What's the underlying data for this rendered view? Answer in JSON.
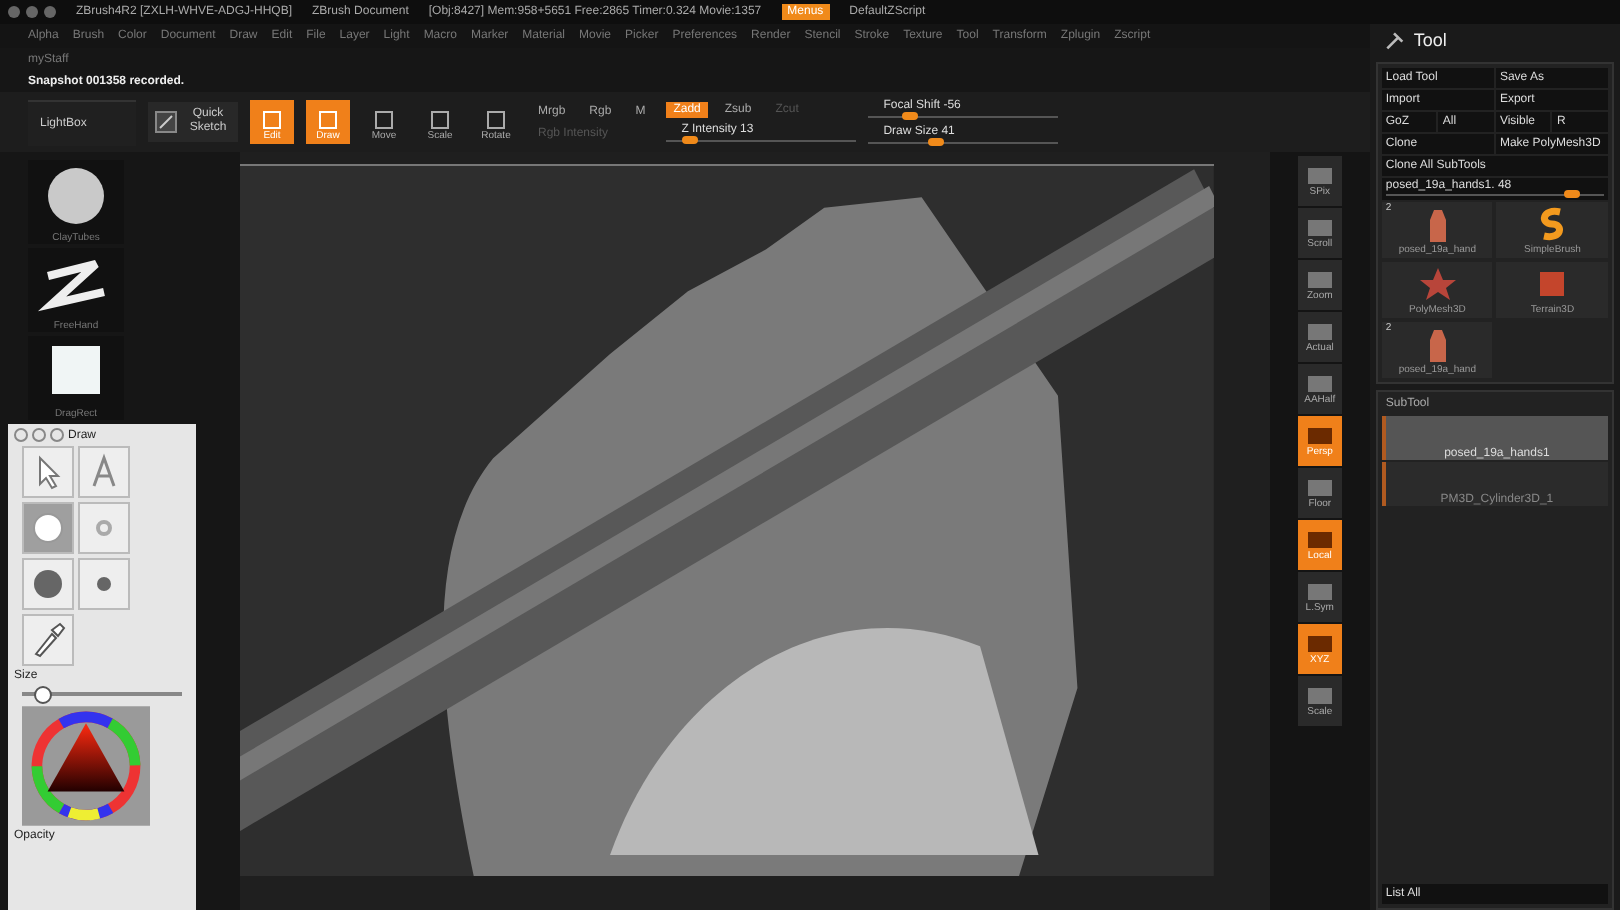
{
  "title_bar": {
    "app": "ZBrush4R2 [ZXLH-WHVE-ADGJ-HHQB]",
    "document": "ZBrush Document",
    "stats": "[Obj:8427] Mem:958+5651 Free:2865 Timer:0.324 Movie:1357",
    "menus_button": {
      "label": "Menus",
      "on": true
    },
    "script": "DefaultZScript"
  },
  "menu_bar": [
    "Alpha",
    "Brush",
    "Color",
    "Document",
    "Draw",
    "Edit",
    "File",
    "Layer",
    "Light",
    "Macro",
    "Marker",
    "Material",
    "Movie",
    "Picker",
    "Preferences",
    "Render",
    "Stencil",
    "Stroke",
    "Texture",
    "Tool",
    "Transform",
    "Zplugin",
    "Zscript"
  ],
  "custom_menu": "myStaff",
  "notice": "Snapshot 001358 recorded.",
  "toolbar": {
    "lightbox": "LightBox",
    "quick_sketch": "Quick Sketch",
    "modes": [
      {
        "label": "Edit",
        "selected": true
      },
      {
        "label": "Draw",
        "selected": true
      },
      {
        "label": "Move",
        "selected": false
      },
      {
        "label": "Scale",
        "selected": false
      },
      {
        "label": "Rotate",
        "selected": false
      }
    ],
    "color_modes": [
      {
        "label": "Mrgb",
        "selected": false
      },
      {
        "label": "Rgb",
        "selected": false
      },
      {
        "label": "M",
        "selected": false
      }
    ],
    "rgb_intensity": {
      "label": "Rgb Intensity",
      "disabled": true
    },
    "depth_modes": [
      {
        "label": "Zadd",
        "selected": true,
        "disabled": false
      },
      {
        "label": "Zsub",
        "selected": false,
        "disabled": false
      },
      {
        "label": "Zcut",
        "selected": false,
        "disabled": true
      }
    ],
    "z_intensity": {
      "label": "Z Intensity 13",
      "level": 0.13
    },
    "focal_shift": {
      "label": "Focal Shift -56",
      "level": 0.22
    },
    "draw_size": {
      "label": "Draw Size 41",
      "level": 0.36
    }
  },
  "left_shelf": {
    "brushes": [
      {
        "label": "ClayTubes",
        "kind": "sphere"
      },
      {
        "label": "FreeHand",
        "kind": "stroke"
      },
      {
        "label": "DragRect",
        "kind": "square"
      }
    ],
    "draw_palette": {
      "title": "Draw",
      "tools": [
        {
          "kind": "pointer",
          "selected": false
        },
        {
          "kind": "text",
          "selected": false
        },
        {
          "kind": "circle",
          "selected": true
        },
        {
          "kind": "ring",
          "selected": false
        },
        {
          "kind": "disc",
          "selected": false
        },
        {
          "kind": "dot",
          "selected": false
        },
        {
          "kind": "dropper",
          "selected": false
        }
      ],
      "size": {
        "label": "Size",
        "level": 0.12
      },
      "opacity_label": "Opacity"
    }
  },
  "right_shelf": [
    {
      "label": "SPix",
      "on": false
    },
    {
      "label": "Scroll",
      "on": false
    },
    {
      "label": "Zoom",
      "on": false
    },
    {
      "label": "Actual",
      "on": false
    },
    {
      "label": "AAHalf",
      "on": false
    },
    {
      "label": "Persp",
      "on": true
    },
    {
      "label": "Floor",
      "on": false
    },
    {
      "label": "Local",
      "on": true
    },
    {
      "label": "L.Sym",
      "on": false
    },
    {
      "label": "XYZ",
      "on": true
    },
    {
      "label": "Scale",
      "on": false
    }
  ],
  "tool_panel": {
    "title": "Tool",
    "button_rows": [
      [
        "Load Tool",
        "Save As"
      ],
      [
        "Import",
        "Export"
      ],
      [
        "GoZ",
        "All",
        "Visible",
        "R"
      ],
      [
        "Clone",
        "Make PolyMesh3D"
      ],
      [
        "Clone All SubTools"
      ]
    ],
    "tool_slider": {
      "label": "posed_19a_hands1. 48",
      "level": 0.85
    },
    "tools": [
      {
        "label": "posed_19a_hand",
        "count": "2",
        "kind": "hand"
      },
      {
        "label": "SimpleBrush",
        "kind": "brush"
      },
      {
        "label": "PolyMesh3D",
        "kind": "star"
      },
      {
        "label": "Terrain3D",
        "kind": "terrain"
      },
      {
        "label": "posed_19a_hand",
        "count": "2",
        "kind": "hand"
      }
    ],
    "subtool": {
      "title": "SubTool",
      "items": [
        {
          "name": "posed_19a_hands1",
          "selected": true
        },
        {
          "name": "PM3D_Cylinder3D_1",
          "selected": false
        }
      ],
      "list_all": "List All"
    }
  }
}
